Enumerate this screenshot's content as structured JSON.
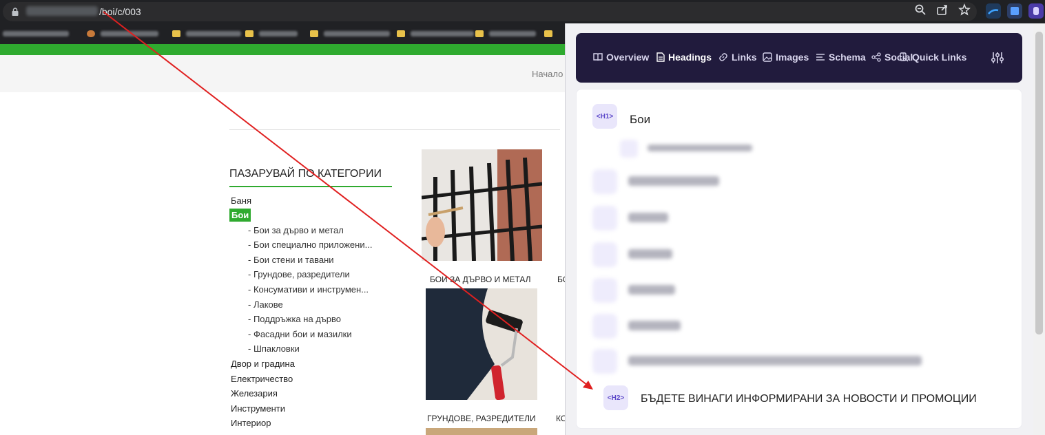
{
  "browser": {
    "url_path": "/boi/c/003",
    "icons": [
      "lock-icon",
      "zoom-icon",
      "share-icon",
      "star-icon"
    ],
    "extensions": [
      "extension-icon",
      "extension-icon",
      "extension-icon"
    ]
  },
  "header": {
    "nav_start": "Начало"
  },
  "sidebar": {
    "title": "ПАЗАРУВАЙ ПО КАТЕГОРИИ",
    "categories_top": [
      {
        "label": "Баня"
      },
      {
        "label": "Бои",
        "active": true
      }
    ],
    "subcategories": [
      {
        "label": "- Бои за дърво и метал"
      },
      {
        "label": "- Бои специално приложени..."
      },
      {
        "label": "- Бои стени и тавани"
      },
      {
        "label": "- Грундове, разредители"
      },
      {
        "label": "- Консумативи и инструмен..."
      },
      {
        "label": "- Лакове"
      },
      {
        "label": "- Поддръжка на дърво"
      },
      {
        "label": "- Фасадни бои и мазилки"
      },
      {
        "label": "- Шпакловки"
      }
    ],
    "categories_bottom": [
      {
        "label": "Двор и градина"
      },
      {
        "label": "Електричество"
      },
      {
        "label": "Железария"
      },
      {
        "label": "Инструменти"
      },
      {
        "label": "Интериор"
      }
    ]
  },
  "products": [
    {
      "label": "БОИ ЗА ДЪРВО И МЕТАЛ"
    },
    {
      "label": "БО"
    },
    {
      "label": "ГРУНДОВЕ, РАЗРЕДИТЕЛИ"
    },
    {
      "label": "КО"
    }
  ],
  "seo_panel": {
    "tabs": [
      {
        "label": "Overview",
        "icon": "book-icon"
      },
      {
        "label": "Headings",
        "icon": "document-icon",
        "active": true
      },
      {
        "label": "Links",
        "icon": "link-icon"
      },
      {
        "label": "Images",
        "icon": "image-icon"
      },
      {
        "label": "Schema",
        "icon": "schema-icon"
      },
      {
        "label": "Social",
        "icon": "share-nodes-icon"
      },
      {
        "label": "Quick Links",
        "icon": "quick-links-icon"
      }
    ],
    "headings": [
      {
        "tag": "<H1>",
        "text": "Бои"
      },
      {
        "tag": "<H2>",
        "text": "БЪДЕТЕ ВИНАГИ ИНФОРМИРАНИ ЗА НОВОСТИ И ПРОМОЦИИ"
      }
    ]
  },
  "colors": {
    "accent_green": "#2faa2f",
    "panel_dark": "#211b3d",
    "badge_bg": "#e9e6fb",
    "badge_text": "#5c48c9",
    "arrow_red": "#e02020"
  }
}
